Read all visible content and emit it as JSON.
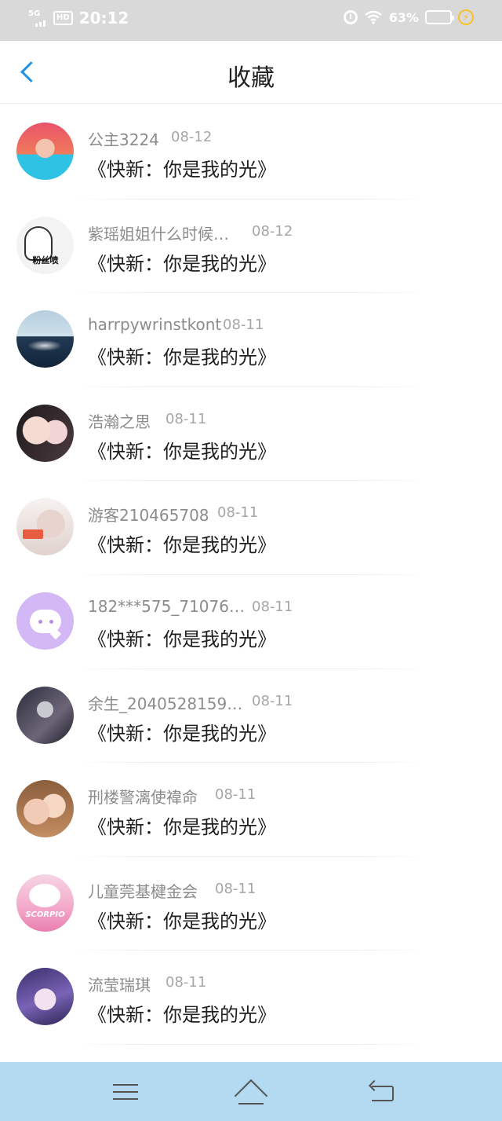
{
  "status_bar": {
    "network": "5G",
    "hd_label": "HD",
    "time": "20:12",
    "battery_percent": "63%",
    "battery_level": 0.63,
    "icons": [
      "signal-icon",
      "alarm-icon",
      "wifi-icon",
      "battery-icon",
      "charging-icon"
    ]
  },
  "header": {
    "back_icon": "chevron-left-icon",
    "title": "收藏"
  },
  "favorites": [
    {
      "name": "公主3224",
      "date": "08-12",
      "book": "《快新：你是我的光》"
    },
    {
      "name": "紫瑶姐姐什么时候…",
      "date": "08-12",
      "book": "《快新：你是我的光》"
    },
    {
      "name": "harrpywrinstkont",
      "date": "08-11",
      "book": "《快新：你是我的光》"
    },
    {
      "name": "浩瀚之思",
      "date": "08-11",
      "book": "《快新：你是我的光》"
    },
    {
      "name": "游客210465708",
      "date": "08-11",
      "book": "《快新：你是我的光》"
    },
    {
      "name": "182***575_71076…",
      "date": "08-11",
      "book": "《快新：你是我的光》"
    },
    {
      "name": "余生_2040528159…",
      "date": "08-11",
      "book": "《快新：你是我的光》"
    },
    {
      "name": "刑楼警漓使禕命",
      "date": "08-11",
      "book": "《快新：你是我的光》"
    },
    {
      "name": "儿童莞基楗金会",
      "date": "08-11",
      "book": "《快新：你是我的光》"
    },
    {
      "name": "流莹瑞琪",
      "date": "08-11",
      "book": "《快新：你是我的光》"
    }
  ],
  "avatar_texts": {
    "item2_caption": "粉丝喷",
    "item5_tag": "",
    "item9_caption": "SCORPIO"
  },
  "nav_bar": {
    "icons": [
      "menu-icon",
      "home-icon",
      "back-icon"
    ],
    "background": "#b3daf0"
  }
}
